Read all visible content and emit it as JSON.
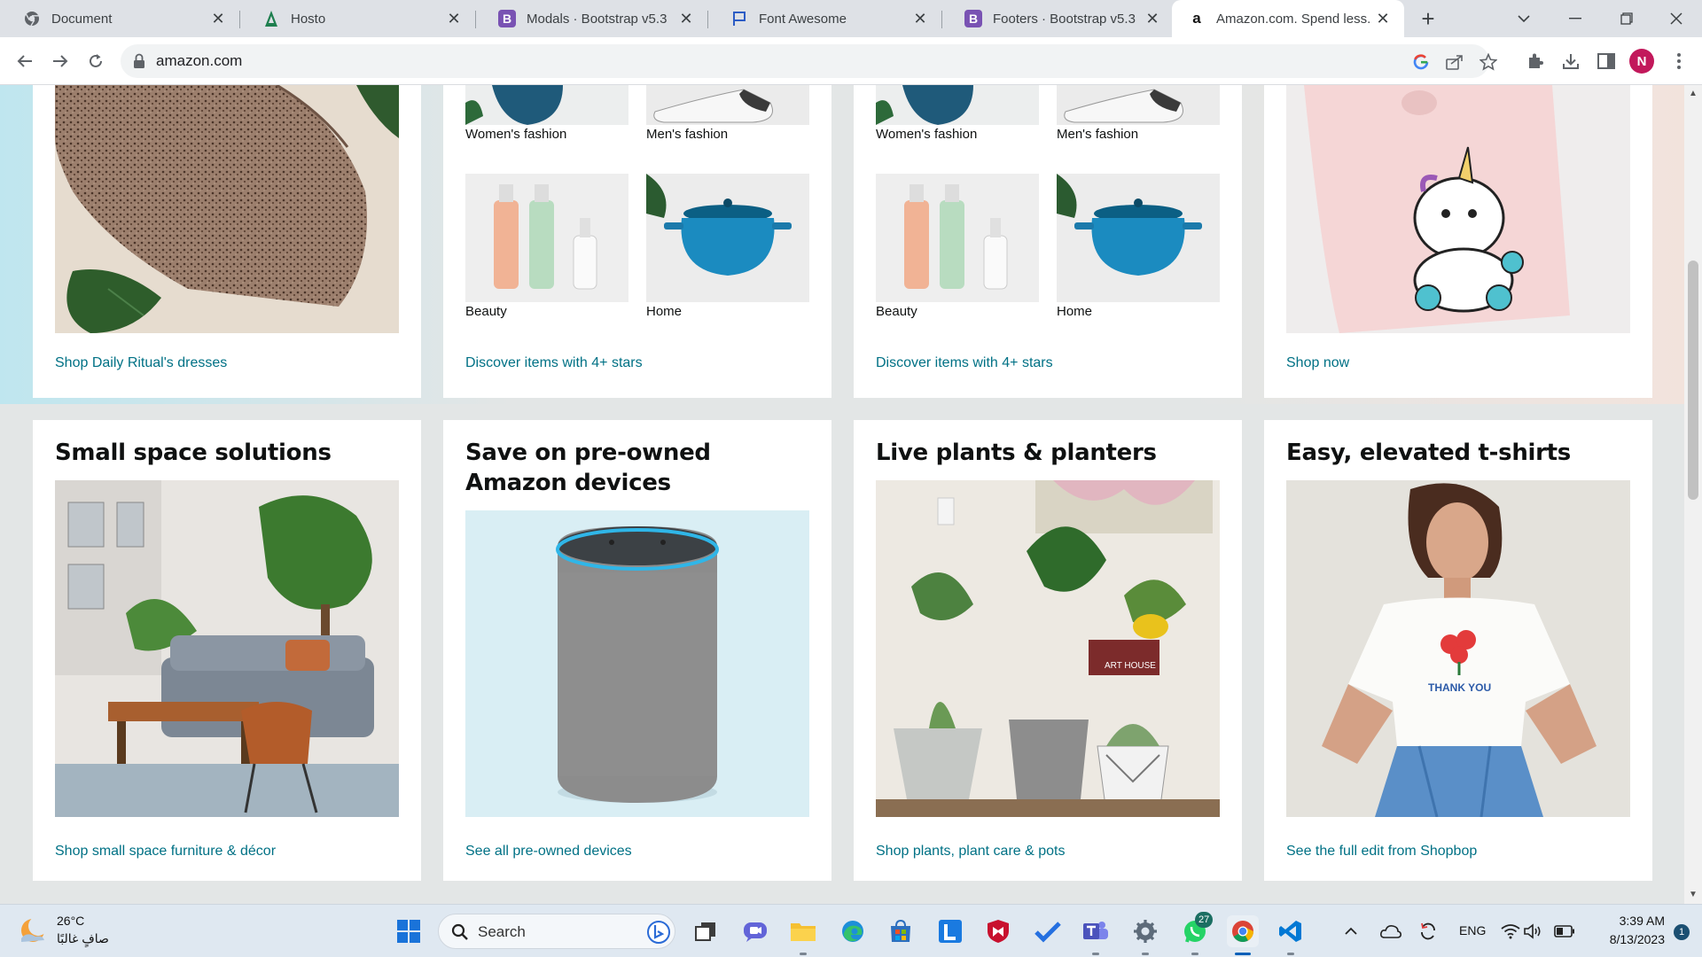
{
  "browser": {
    "tabs": [
      {
        "title": "Document",
        "icon": "chrome-favicon",
        "active": false
      },
      {
        "title": "Hosto",
        "icon": "hosto-favicon",
        "active": false
      },
      {
        "title": "Modals · Bootstrap v5.3",
        "icon": "bootstrap-favicon",
        "active": false
      },
      {
        "title": "Font Awesome",
        "icon": "flag-favicon",
        "active": false
      },
      {
        "title": "Footers · Bootstrap v5.3",
        "icon": "bootstrap-favicon",
        "active": false
      },
      {
        "title": "Amazon.com. Spend less. S",
        "icon": "amazon-favicon",
        "active": true
      }
    ],
    "url": "amazon.com",
    "profile_initial": "N",
    "bootstrap_letter": "B",
    "amazon_letter": "a"
  },
  "colors": {
    "link": "#007185",
    "bootstrap_purple": "#7952b3",
    "profile": "#c2185b",
    "teal_badge": "#1b6e62"
  },
  "top_cards": [
    {
      "link": "Shop Daily Ritual's dresses"
    },
    {
      "items": [
        {
          "label": "Women's fashion"
        },
        {
          "label": "Men's fashion"
        },
        {
          "label": "Beauty"
        },
        {
          "label": "Home"
        }
      ],
      "link": "Discover items with 4+ stars"
    },
    {
      "items": [
        {
          "label": "Women's fashion"
        },
        {
          "label": "Men's fashion"
        },
        {
          "label": "Beauty"
        },
        {
          "label": "Home"
        }
      ],
      "link": "Discover items with 4+ stars"
    },
    {
      "link": "Shop now"
    }
  ],
  "bottom_cards": [
    {
      "title": "Small space solutions",
      "link": "Shop small space furniture & décor"
    },
    {
      "title": "Save on pre-owned Amazon devices",
      "link": "See all pre-owned devices"
    },
    {
      "title": "Live plants & planters",
      "link": "Shop plants, plant care & pots"
    },
    {
      "title": "Easy, elevated t-shirts",
      "link": "See the full edit from Shopbop"
    }
  ],
  "image_text": {
    "tshirt_print": "THANK YOU",
    "book_spine": "ART HOUSE"
  },
  "taskbar": {
    "weather_temp": "26°C",
    "weather_cond": "صافٍ غالبًا",
    "search_placeholder": "Search",
    "teams_badge": "",
    "whatsapp_badge": "27",
    "language": "ENG",
    "time": "3:39 AM",
    "date": "8/13/2023",
    "notification_count": "1"
  }
}
